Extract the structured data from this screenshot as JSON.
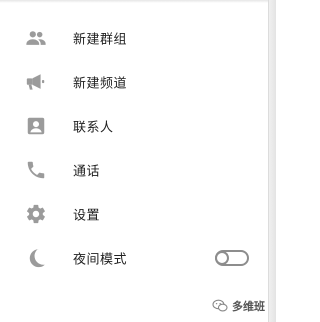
{
  "menu": {
    "items": [
      {
        "label": "新建群组",
        "icon": "group-icon"
      },
      {
        "label": "新建频道",
        "icon": "megaphone-icon"
      },
      {
        "label": "联系人",
        "icon": "contact-card-icon"
      },
      {
        "label": "通话",
        "icon": "phone-icon"
      },
      {
        "label": "设置",
        "icon": "gear-icon"
      },
      {
        "label": "夜间模式",
        "icon": "moon-icon"
      }
    ],
    "night_mode": {
      "on": false
    }
  },
  "watermark": {
    "text": "多维班"
  },
  "colors": {
    "icon": "#9b9b9b",
    "text": "#222222",
    "toggle": "#8d8d8d"
  }
}
